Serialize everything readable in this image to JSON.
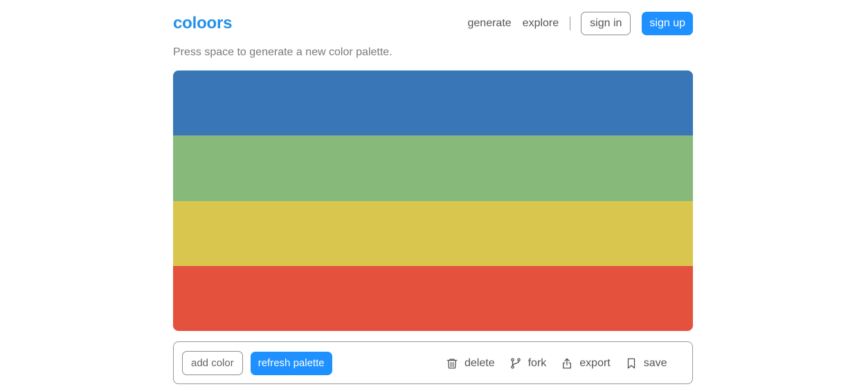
{
  "brand": {
    "name": "coloors",
    "color": "#2590e8"
  },
  "nav": {
    "generate": "generate",
    "explore": "explore",
    "sign_in": "sign in",
    "sign_up": "sign up"
  },
  "hint": "Press space to generate a new color palette.",
  "palette": {
    "colors": [
      "#3876b7",
      "#87b97b",
      "#d9c64f",
      "#e4513d"
    ]
  },
  "toolbar": {
    "add_color": "add color",
    "refresh_palette": "refresh palette",
    "actions": [
      {
        "label": "delete",
        "icon": "trash-icon"
      },
      {
        "label": "fork",
        "icon": "fork-icon"
      },
      {
        "label": "export",
        "icon": "share-icon"
      },
      {
        "label": "save",
        "icon": "bookmark-icon"
      }
    ]
  },
  "accent_color": "#1e90ff"
}
